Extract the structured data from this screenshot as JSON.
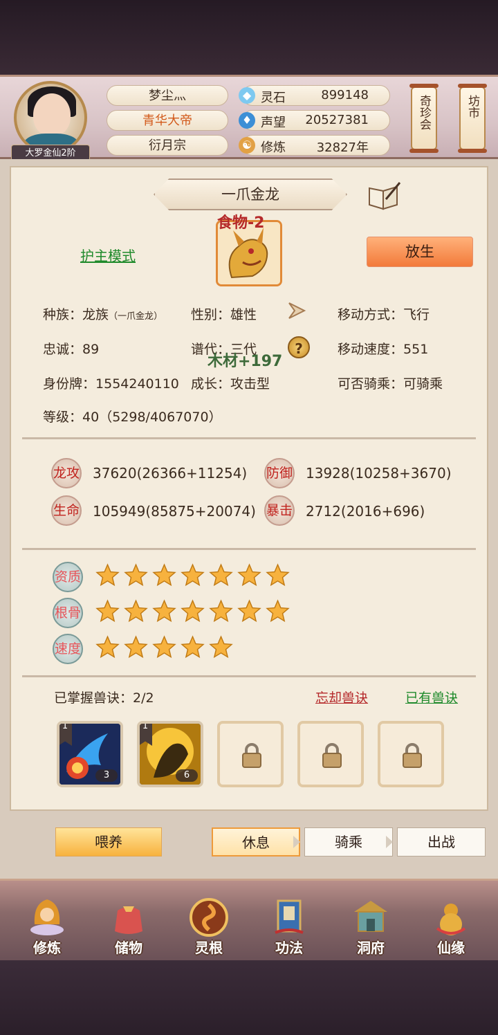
{
  "header": {
    "player_name": "梦尘灬",
    "title": "青华大帝",
    "sect": "衍月宗",
    "rank": "大罗金仙2阶",
    "resources": [
      {
        "icon": "spirit-stone-icon",
        "label": "灵石",
        "value": "899148"
      },
      {
        "icon": "reputation-icon",
        "label": "声望",
        "value": "20527381"
      },
      {
        "icon": "cultivation-icon",
        "label": "修炼",
        "value": "32827年"
      }
    ],
    "shop_buttons": [
      "奇珍会",
      "坊市"
    ]
  },
  "pet": {
    "name": "一爪金龙",
    "food_popup": "食物-2",
    "wood_popup": "木材+197",
    "guard_mode": "护主模式",
    "release": "放生",
    "attributes": {
      "race_label": "种族：",
      "race": "龙族",
      "race_sub": "一爪金龙",
      "gender_label": "性别：",
      "gender": "雄性",
      "move_label": "移动方式：",
      "move": "飞行",
      "loyalty_label": "忠诚：",
      "loyalty": "89",
      "gen_label": "谱代：",
      "gen": "三代",
      "speed_label": "移动速度：",
      "speed": "551",
      "id_label": "身份牌：",
      "id": "1554240110",
      "growth_label": "成长：",
      "growth": "攻击型",
      "ride_label": "可否骑乘：",
      "ride": "可骑乘",
      "level_label": "等级：",
      "level": "40（5298/4067070）"
    },
    "combat": [
      {
        "badge": "龙攻",
        "value": "37620(26366+11254)"
      },
      {
        "badge": "防御",
        "value": "13928(10258+3670)"
      },
      {
        "badge": "生命",
        "value": "105949(85875+20074)"
      },
      {
        "badge": "暴击",
        "value": "2712(2016+696)"
      }
    ],
    "qualities": [
      {
        "badge": "资质",
        "stars": 7
      },
      {
        "badge": "根骨",
        "stars": 7
      },
      {
        "badge": "速度",
        "stars": 5
      }
    ],
    "skills": {
      "mastered": "已掌握兽诀：2/2",
      "forget": "忘却兽诀",
      "owned": "已有兽诀",
      "slots": [
        {
          "level": "1",
          "count": "3"
        },
        {
          "level": "1",
          "count": "6"
        }
      ]
    }
  },
  "actions": {
    "feed": "喂养",
    "tabs": [
      "休息",
      "骑乘",
      "出战"
    ]
  },
  "nav": [
    "修炼",
    "储物",
    "灵根",
    "功法",
    "洞府",
    "仙缘"
  ],
  "colors": {
    "accent_orange": "#f27a3a",
    "link_green": "#1f8a2b",
    "link_red": "#b5292a",
    "star_gold": "#f7b23e"
  }
}
